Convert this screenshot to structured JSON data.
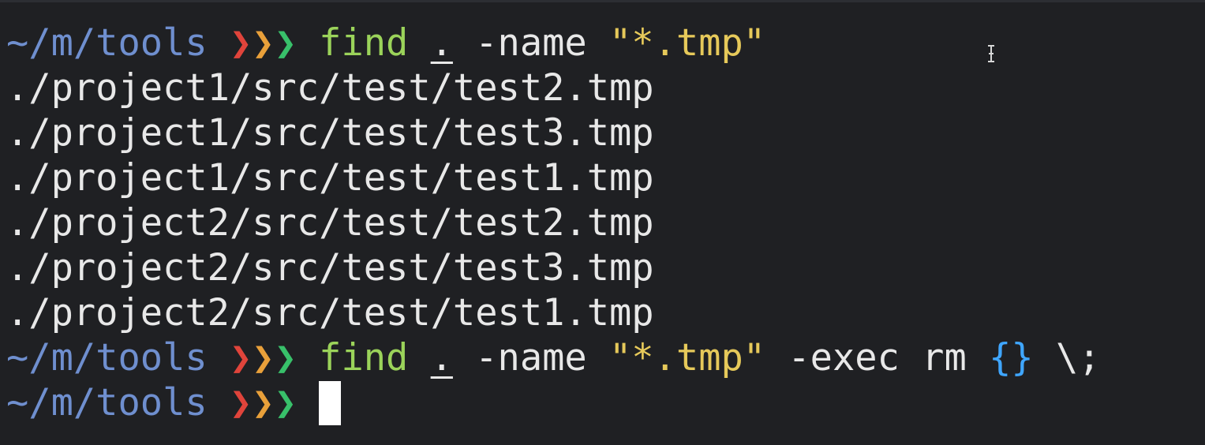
{
  "terminal": {
    "prompt": {
      "cwd": "~/m/tools",
      "chevron1": "❯",
      "chevron2": "❯",
      "chevron3": "❯"
    },
    "line1": {
      "cmd": "find",
      "dot": ".",
      "opt": "-name",
      "pattern": "\"*.tmp\""
    },
    "output": [
      "./project1/src/test/test2.tmp",
      "./project1/src/test/test3.tmp",
      "./project1/src/test/test1.tmp",
      "./project2/src/test/test2.tmp",
      "./project2/src/test/test3.tmp",
      "./project2/src/test/test1.tmp"
    ],
    "line2": {
      "cmd": "find",
      "dot": ".",
      "opt": "-name",
      "pattern": "\"*.tmp\"",
      "exec": "-exec",
      "rm": "rm",
      "braces": "{}",
      "terminator": "\\;"
    },
    "colors": {
      "background": "#1f2023",
      "cwd": "#6f8fcf",
      "chevron_red": "#e0443b",
      "chevron_orange": "#e9a03a",
      "chevron_green": "#38c06a",
      "command": "#9bd35a",
      "string": "#e6c95a",
      "braces": "#3fa6ff",
      "text": "#e8e8e8"
    }
  }
}
